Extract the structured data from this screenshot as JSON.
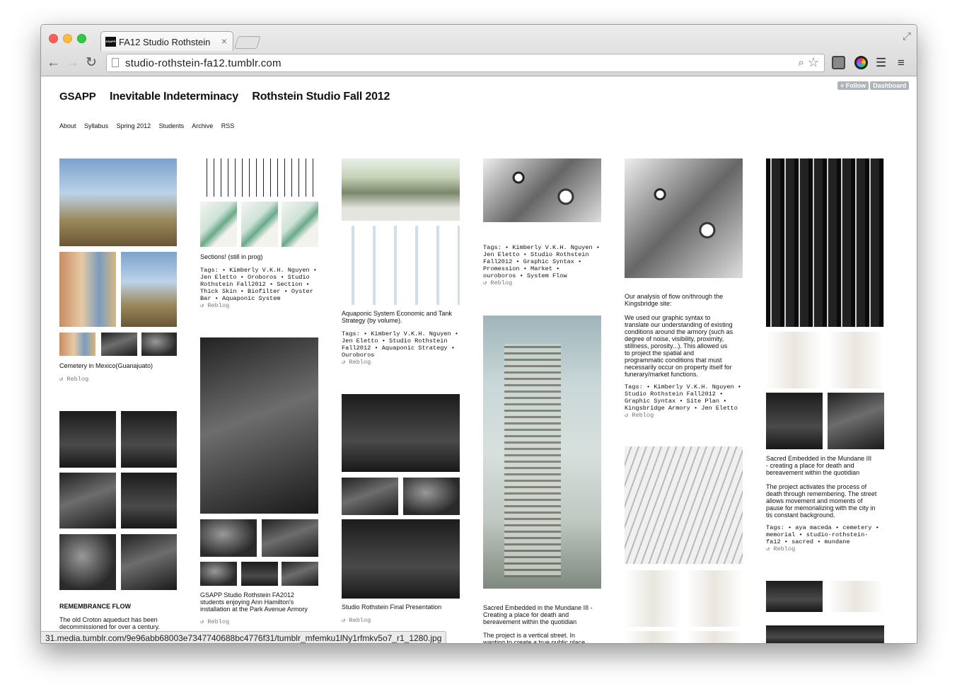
{
  "tab": {
    "title": "FA12 Studio Rothstein",
    "favicon_text": "GSAPP"
  },
  "address_bar": {
    "url": "studio-rothstein-fa12.tumblr.com"
  },
  "controls": {
    "follow": "+ Follow",
    "dashboard": "Dashboard"
  },
  "blog": {
    "title_parts": [
      "GSAPP",
      "Inevitable Indeterminacy",
      "Rothstein Studio Fall 2012"
    ],
    "nav": [
      "About",
      "Syllabus",
      "Spring 2012",
      "Students",
      "Archive",
      "RSS"
    ]
  },
  "posts": {
    "cemetery": {
      "caption": "Cemetery in Mexico(Guanajuato)",
      "reblog": "Reblog"
    },
    "remembrance": {
      "caption_title": "REMEMBRANCE FLOW",
      "caption_body": "The old Croton aqueduct has been\ndecommissioned for over a century."
    },
    "sections": {
      "caption": "Sections! (still in prog)",
      "tags": "Tags:  • Kimberly V.K.H. Nguyen  •\nJen Eletto  • Oroboros  • Studio\nRothstein Fall2012  • Section  •\nThick Skin  • Biofilter  • Oyster\nBar  • Aquaponic System",
      "reblog": "Reblog"
    },
    "hamilton": {
      "caption": "GSAPP Studio Rothstein FA2012\nstudents enjoying Ann Hamilton's\ninstallation at the Park Avenue Armory",
      "reblog": "Reblog"
    },
    "aquaponic": {
      "caption": "Aquaponic System Economic and Tank\nStrategy (by volume).",
      "tags": "Tags:  • Kimberly V.K.H. Nguyen  •\nJen Eletto  • Studio Rothstein\nFall2012  • Aquaponic Strategy  •\nOuroboros",
      "reblog": "Reblog"
    },
    "final": {
      "caption": "Studio Rothstein Final Presentation",
      "reblog": "Reblog"
    },
    "promession": {
      "tags": "Tags:  • Kimberly V.K.H. Nguyen  •\nJen Eletto  • Studio Rothstein\nFall2012  • Graphic Syntax  •\nPromession  • Market  •\nouroboros  • System Flow",
      "reblog": "Reblog"
    },
    "mundane_tower": {
      "caption": "Sacred Embedded in the Mundane III -\nCreating a place for death and\nbereavement within the quotidian",
      "body": "The project is a vertical street. In\nwanting to create a true public place"
    },
    "analysis": {
      "caption": "Our analysis of flow on/through the\nKingsbridge site:\n\nWe used our graphic syntax to\ntranslate our understanding of existing\nconditions around the armory (such as\ndegree of noise, visibility, proximity,\nstillness, porosity...).  This allowed us\nto project the spatial and\nprogrammatic conditions that must\nnecessarily occur on property itself for\nfunerary/market functions.",
      "tags": "Tags:  • Kimberly V.K.H. Nguyen  •\nStudio Rothstein Fall2012  •\nGraphic Syntax  • Site Plan  •\nKingsbridge Armory  • Jen Eletto",
      "reblog": "Reblog"
    },
    "sacred": {
      "caption": "Sacred Embedded in the Mundane III\n- creating a place for death and\nbereavement within the quotidian\n\nThe project activates the process of\ndeath through remembering. The street\nallows movement and moments of\npause for memorializing with the city in\ntis constant background.",
      "tags": "Tags:  • aya maceda  • cemetery  •\nmemorial  • studio-rothstein-\nfa12  • sacred  • mundane",
      "reblog": "Reblog"
    }
  },
  "status_bar": {
    "text": "31.media.tumblr.com/9e96abb68003e7347740688bc4776f31/tumblr_mfemku1lNy1rfmkv5o7_r1_1280.jpg"
  }
}
